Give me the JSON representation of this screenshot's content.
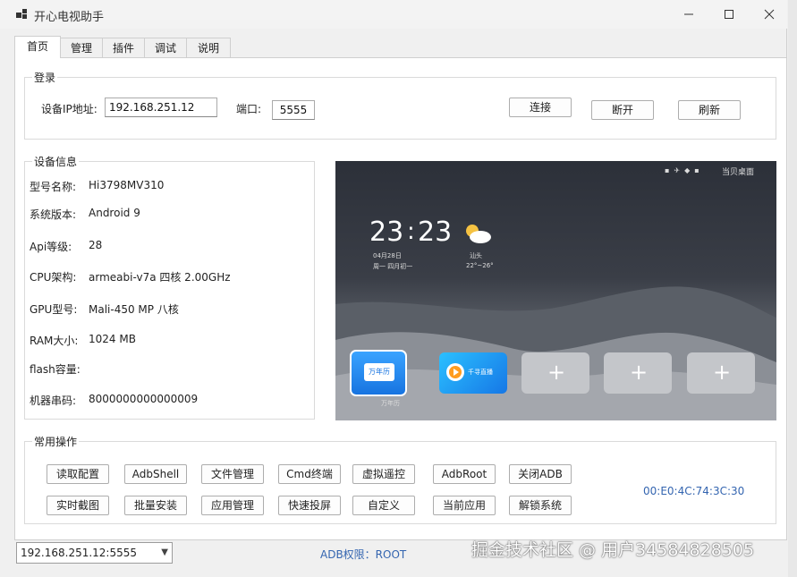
{
  "window": {
    "title": "开心电视助手"
  },
  "tabs": [
    {
      "label": "首页"
    },
    {
      "label": "管理"
    },
    {
      "label": "插件"
    },
    {
      "label": "调试"
    },
    {
      "label": "说明"
    }
  ],
  "login": {
    "group_title": "登录",
    "ip_label": "设备IP地址:",
    "ip_value": "192.168.251.12",
    "port_label": "端口:",
    "port_value": "5555",
    "connect": "连接",
    "disconnect": "断开",
    "refresh": "刷新"
  },
  "device_info": {
    "group_title": "设备信息",
    "rows": [
      {
        "label": "型号名称:",
        "value": "Hi3798MV310"
      },
      {
        "label": "系统版本:",
        "value": "Android 9"
      },
      {
        "label": "Api等级:",
        "value": "28"
      },
      {
        "label": "CPU架构:",
        "value": "armeabi-v7a 四核 2.00GHz"
      },
      {
        "label": "GPU型号:",
        "value": "Mali-450 MP 八核"
      },
      {
        "label": "RAM大小:",
        "value": "1024 MB"
      },
      {
        "label": "flash容量:",
        "value": ""
      },
      {
        "label": "机器串码:",
        "value": "8000000000000009"
      }
    ]
  },
  "tv_screen": {
    "time_h": "23",
    "time_m": "23",
    "date": "04月28日",
    "weekday": "周一 四月初一",
    "city": "汕头",
    "temp": "22°~26°",
    "status_text": "当贝桌面",
    "apps": [
      {
        "name": "万年历",
        "caption": "万年历"
      },
      {
        "name": "千寻直播"
      }
    ]
  },
  "ops": {
    "group_title": "常用操作",
    "row1": [
      "读取配置",
      "AdbShell",
      "文件管理",
      "Cmd终端",
      "虚拟遥控",
      "AdbRoot",
      "关闭ADB"
    ],
    "row2": [
      "实时截图",
      "批量安装",
      "应用管理",
      "快速投屏",
      "自定义",
      "当前应用",
      "解锁系统"
    ],
    "mac": "00:E0:4C:74:3C:30"
  },
  "status_bar": {
    "device_select": "192.168.251.12:5555",
    "adb_permission": "ADB权限：ROOT"
  },
  "watermark": "掘金技术社区 @ 用户34584828505",
  "colors": {
    "accent_blue": "#3465b0",
    "app_blue": "#1f8ef0",
    "window_bg": "#f0f0f0"
  }
}
